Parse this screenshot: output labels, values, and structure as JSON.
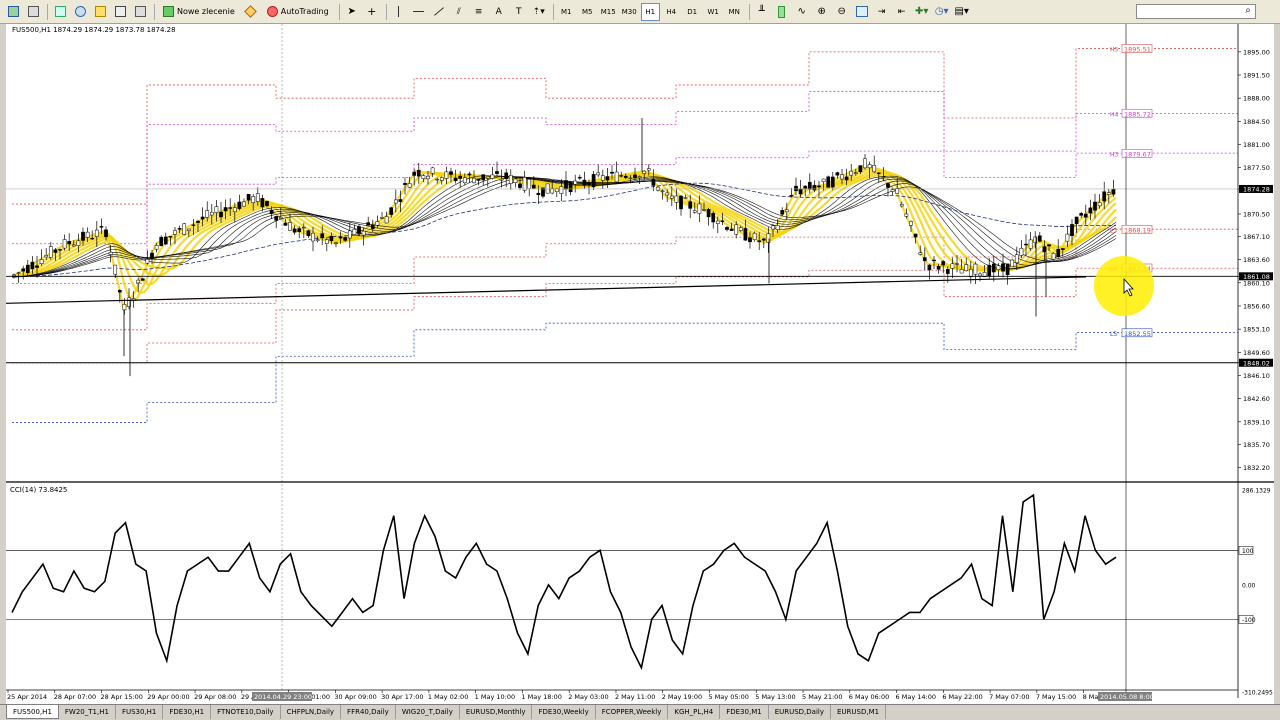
{
  "toolbar": {
    "new_order_label": "Nowe zlecenie",
    "autotrading_label": "AutoTrading",
    "timeframes": [
      "M1",
      "M5",
      "M15",
      "M30",
      "H1",
      "H4",
      "D1",
      "W1",
      "MN"
    ],
    "active_timeframe": "H1",
    "drawing_tools": [
      "cursor-icon",
      "crosshair-icon",
      "vertical-line-icon",
      "horizontal-line-icon",
      "trendline-icon",
      "channel-icon",
      "fibonacci-icon",
      "text-icon",
      "arrow-icon"
    ]
  },
  "chart": {
    "header": "FUS500,H1  1874.29 1874.29 1873.78 1874.28",
    "price_labels": [
      "1895.00",
      "1891.50",
      "1888.00",
      "1884.50",
      "1881.00",
      "1877.50",
      "1874.28",
      "1870.50",
      "1867.10",
      "1863.60",
      "1861.08",
      "1860.10",
      "1856.60",
      "1853.10",
      "1849.60",
      "1848.02",
      "1846.10",
      "1842.60",
      "1839.10",
      "1835.70",
      "1832.20"
    ],
    "current_price": "1874.28",
    "hline_price_1": "1861.08",
    "hline_price_2": "1848.02",
    "pivot_labels": [
      {
        "name": "H5",
        "value": "1895.51"
      },
      {
        "name": "H4",
        "value": "1885.72"
      },
      {
        "name": "H3",
        "value": "1879.67"
      },
      {
        "name": "L3",
        "value": "1868.19"
      },
      {
        "name": "L4",
        "value": "1862.34"
      },
      {
        "name": "L5",
        "value": "1852.55"
      }
    ],
    "time_labels": [
      "25 Apr 2014",
      "28 Apr 07:00",
      "28 Apr 15:00",
      "29 Apr 00:00",
      "29 Apr 08:00",
      "29 Apr 16:00",
      "30 Apr 01:00",
      "30 Apr 09:00",
      "30 Apr 17:00",
      "1 May 02:00",
      "1 May 10:00",
      "1 May 18:00",
      "2 May 03:00",
      "2 May 11:00",
      "2 May 19:00",
      "5 May 05:00",
      "5 May 13:00",
      "5 May 21:00",
      "6 May 06:00",
      "6 May 14:00",
      "6 May 22:00",
      "7 May 07:00",
      "7 May 15:00",
      "8 May 00:00"
    ],
    "crosshair_time_left": "2014.04.29 23:00",
    "crosshair_time_right": "2014.05.08 8:00"
  },
  "cci": {
    "header": "CCI(14) 73.8425",
    "scale_labels": [
      "286.1329",
      "100",
      "0.00",
      "-100",
      "-310.2495"
    ]
  },
  "tabs": [
    "FUS500,H1",
    "FW20_T1,H1",
    "FUS30,H1",
    "FDE30,H1",
    "FTNOTE10,Daily",
    "CHFPLN,Daily",
    "FFR40,Daily",
    "WIG20_T,Daily",
    "EURUSD,Monthly",
    "FDE30,Weekly",
    "FCOPPER,Weekly",
    "KGH_PL,H4",
    "FDE30,M1",
    "EURUSD,Daily",
    "EURUSD,M1"
  ],
  "active_tab": "FUS500,H1",
  "colors": {
    "ma_band": "#f5d30c",
    "ma_lines": "#000000",
    "pivot_red": "#e05050",
    "pivot_magenta": "#d040d0",
    "pivot_blue": "#3050c0",
    "cursor_highlight": "#ffee00",
    "candle": "#000000"
  }
}
